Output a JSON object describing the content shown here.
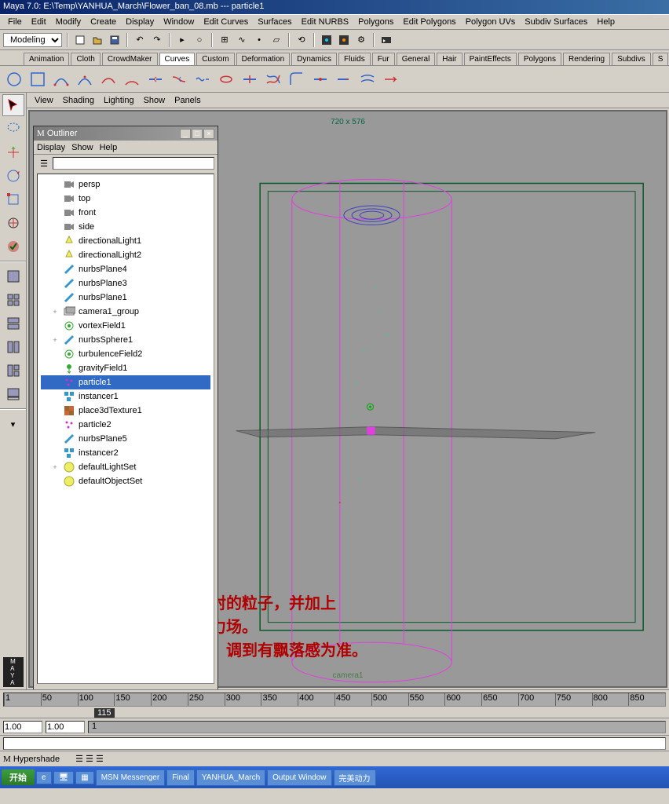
{
  "title": "Maya 7.0: E:\\Temp\\YANHUA_March\\Flower_ban_08.mb  ---  particle1",
  "menus": [
    "File",
    "Edit",
    "Modify",
    "Create",
    "Display",
    "Window",
    "Edit Curves",
    "Surfaces",
    "Edit NURBS",
    "Polygons",
    "Edit Polygons",
    "Polygon UVs",
    "Subdiv Surfaces",
    "Help"
  ],
  "mode_dropdown": "Modeling",
  "shelf_tabs": [
    "Animation",
    "Cloth",
    "CrowdMaker",
    "Curves",
    "Custom",
    "Deformation",
    "Dynamics",
    "Fluids",
    "Fur",
    "General",
    "Hair",
    "PaintEffects",
    "Polygons",
    "Rendering",
    "Subdivs",
    "S"
  ],
  "shelf_active": 3,
  "vp_menus": [
    "View",
    "Shading",
    "Lighting",
    "Show",
    "Panels"
  ],
  "vp_resolution": "720 x 576",
  "vp_camera": "camera1",
  "outliner": {
    "title": "Outliner",
    "menus": [
      "Display",
      "Show",
      "Help"
    ],
    "filter": "",
    "items": [
      {
        "icon": "camera",
        "label": "persp",
        "indent": 1,
        "exp": ""
      },
      {
        "icon": "camera",
        "label": "top",
        "indent": 1,
        "exp": ""
      },
      {
        "icon": "camera",
        "label": "front",
        "indent": 1,
        "exp": ""
      },
      {
        "icon": "camera",
        "label": "side",
        "indent": 1,
        "exp": ""
      },
      {
        "icon": "light",
        "label": "directionalLight1",
        "indent": 1,
        "exp": ""
      },
      {
        "icon": "light",
        "label": "directionalLight2",
        "indent": 1,
        "exp": ""
      },
      {
        "icon": "nurbs",
        "label": "nurbsPlane4",
        "indent": 1,
        "exp": ""
      },
      {
        "icon": "nurbs",
        "label": "nurbsPlane3",
        "indent": 1,
        "exp": ""
      },
      {
        "icon": "nurbs",
        "label": "nurbsPlane1",
        "indent": 1,
        "exp": ""
      },
      {
        "icon": "group",
        "label": "camera1_group",
        "indent": 1,
        "exp": "+"
      },
      {
        "icon": "field",
        "label": "vortexField1",
        "indent": 1,
        "exp": ""
      },
      {
        "icon": "nurbs",
        "label": "nurbsSphere1",
        "indent": 1,
        "exp": "+"
      },
      {
        "icon": "field",
        "label": "turbulenceField2",
        "indent": 1,
        "exp": ""
      },
      {
        "icon": "gravity",
        "label": "gravityField1",
        "indent": 1,
        "exp": ""
      },
      {
        "icon": "particle",
        "label": "particle1",
        "indent": 1,
        "exp": "",
        "selected": true
      },
      {
        "icon": "instancer",
        "label": "instancer1",
        "indent": 1,
        "exp": ""
      },
      {
        "icon": "texture",
        "label": "place3dTexture1",
        "indent": 1,
        "exp": ""
      },
      {
        "icon": "particle",
        "label": "particle2",
        "indent": 1,
        "exp": ""
      },
      {
        "icon": "nurbs",
        "label": "nurbsPlane5",
        "indent": 1,
        "exp": ""
      },
      {
        "icon": "instancer",
        "label": "instancer2",
        "indent": 1,
        "exp": ""
      },
      {
        "icon": "set",
        "label": "defaultLightSet",
        "indent": 1,
        "exp": "+"
      },
      {
        "icon": "set",
        "label": "defaultObjectSet",
        "indent": 1,
        "exp": ""
      }
    ]
  },
  "timeline_ticks": [
    "1",
    "50",
    "100",
    "150",
    "200",
    "250",
    "300",
    "350",
    "400",
    "450",
    "500",
    "550",
    "600",
    "650",
    "700",
    "750",
    "800",
    "850"
  ],
  "timeline_cursor": "115",
  "range_start": "1.00",
  "range_end": "1.00",
  "range_slider": "1",
  "hypershade": "Hypershade",
  "taskbar": {
    "start": "开始",
    "tasks": [
      "MSN Messenger",
      "Final",
      "YANHUA_March",
      "Output Window",
      "完美动力"
    ]
  },
  "annotation": "先创建一个用物体发射的粒子，并加上\n旋涡场、扰乱场和重力场。\n把粒子数量调少一些，调到有飘落感为准。"
}
